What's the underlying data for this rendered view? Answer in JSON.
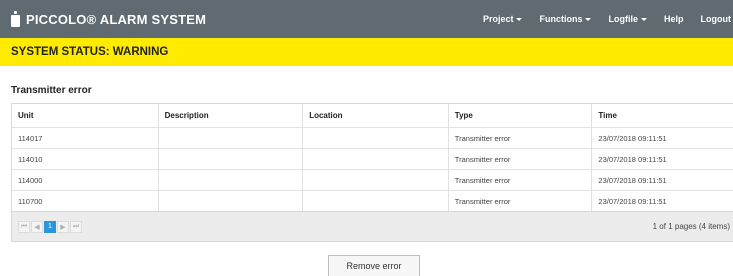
{
  "navbar": {
    "brand": "PICCOLO® ALARM SYSTEM",
    "logo_icon": "piccolo-logo-icon",
    "menu": [
      {
        "label": "Project",
        "dropdown": true
      },
      {
        "label": "Functions",
        "dropdown": true
      },
      {
        "label": "Logfile",
        "dropdown": true
      },
      {
        "label": "Help",
        "dropdown": false
      },
      {
        "label": "Logout",
        "dropdown": false
      }
    ]
  },
  "status": {
    "text": "SYSTEM STATUS: WARNING",
    "color": "#ffeb00"
  },
  "section": {
    "title": "Transmitter error"
  },
  "grid": {
    "columns": [
      "Unit",
      "Description",
      "Location",
      "Type",
      "Time"
    ],
    "rows": [
      [
        "114017",
        "",
        "",
        "Transmitter error",
        "23/07/2018 09:11:51"
      ],
      [
        "114010",
        "",
        "",
        "Transmitter error",
        "23/07/2018 09:11:51"
      ],
      [
        "114000",
        "",
        "",
        "Transmitter error",
        "23/07/2018 09:11:51"
      ],
      [
        "110700",
        "",
        "",
        "Transmitter error",
        "23/07/2018 09:11:51"
      ]
    ]
  },
  "pager": {
    "first": "⏮",
    "prev": "◀",
    "current_page": "1",
    "next": "▶",
    "last": "⏭",
    "info": "1 of 1 pages (4 items)"
  },
  "actions": {
    "remove_label": "Remove error"
  },
  "colors": {
    "navbar": "#5f6b70",
    "accent": "#2c96d8"
  }
}
